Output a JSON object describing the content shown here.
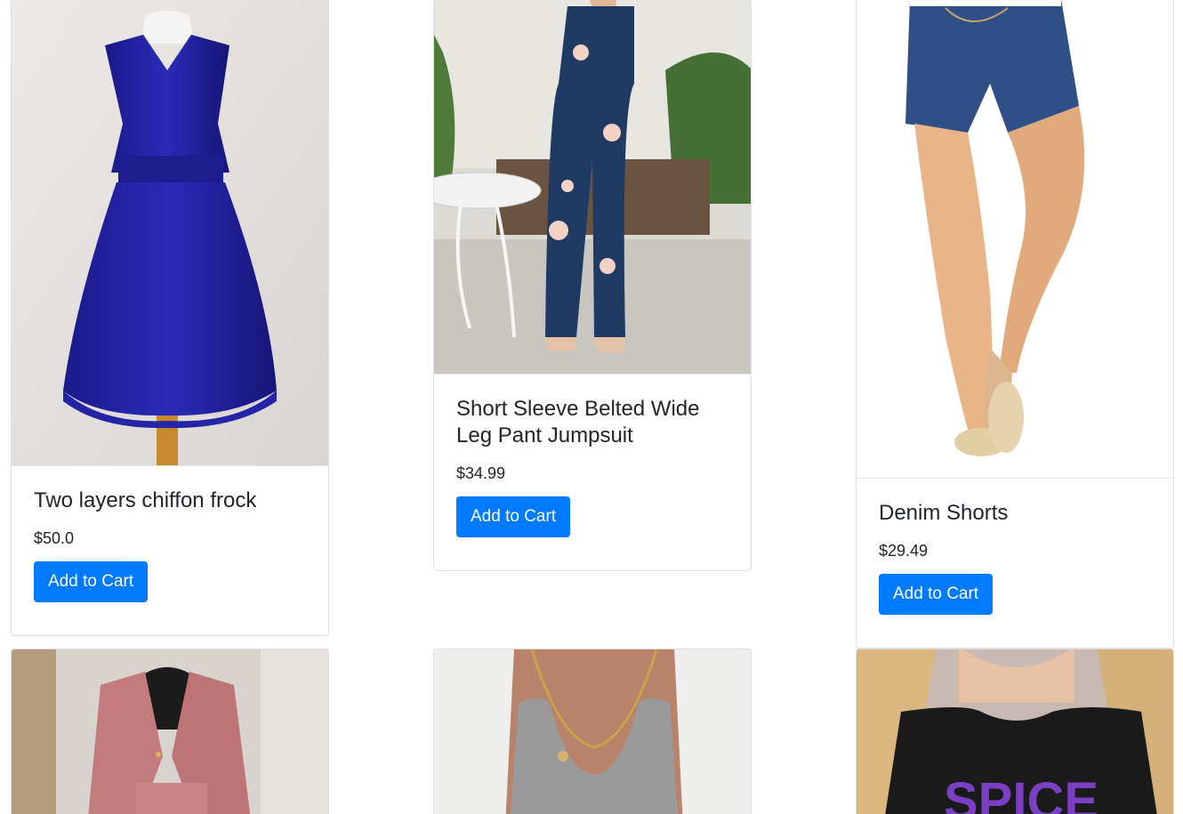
{
  "products": [
    {
      "title": "Two layers chiffon frock",
      "price": "$50.0",
      "button": "Add to Cart"
    },
    {
      "title": "Short Sleeve Belted Wide Leg Pant Jumpsuit",
      "price": "$34.99",
      "button": "Add to Cart"
    },
    {
      "title": "Denim Shorts",
      "price": "$29.49",
      "button": "Add to Cart"
    },
    {
      "title": "",
      "price": "",
      "button": ""
    },
    {
      "title": "",
      "price": "",
      "button": ""
    },
    {
      "title": "",
      "price": "",
      "button": ""
    }
  ],
  "images": {
    "tee_print": "SPICE"
  }
}
